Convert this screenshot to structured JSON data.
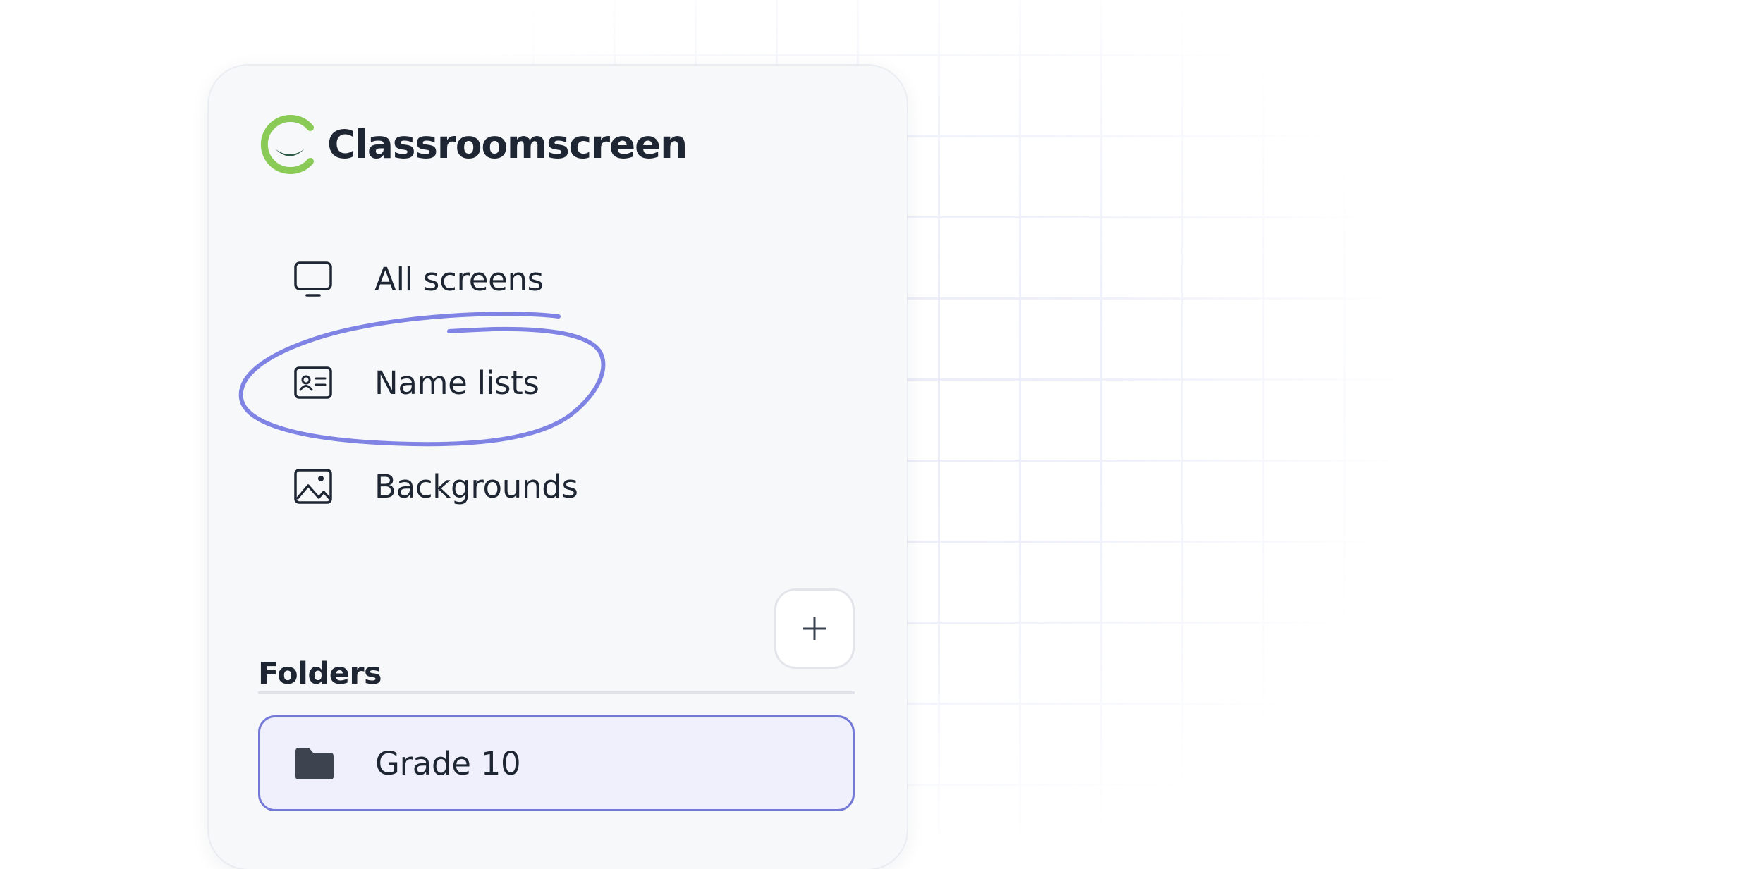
{
  "brand": {
    "name": "Classroomscreen",
    "mark_icon": "classroomscreen-logo-icon",
    "colors": {
      "mark_green": "#8acb58",
      "mark_dark": "#2c5a45",
      "text": "#1e2633"
    }
  },
  "nav": {
    "items": [
      {
        "label": "All screens",
        "icon": "monitor-icon"
      },
      {
        "label": "Name lists",
        "icon": "contact-card-icon"
      },
      {
        "label": "Backgrounds",
        "icon": "image-icon"
      }
    ]
  },
  "folders": {
    "title": "Folders",
    "add_icon": "plus-icon",
    "items": [
      {
        "label": "Grade 10",
        "icon": "folder-icon",
        "selected": true
      }
    ]
  },
  "annotation": {
    "type": "hand-drawn circle",
    "target": "Name lists",
    "color": "#7f83e4"
  },
  "theme": {
    "accent": "#7479d8",
    "selected_bg": "#eff0fb",
    "sidebar_bg": "#f7f8fa"
  }
}
